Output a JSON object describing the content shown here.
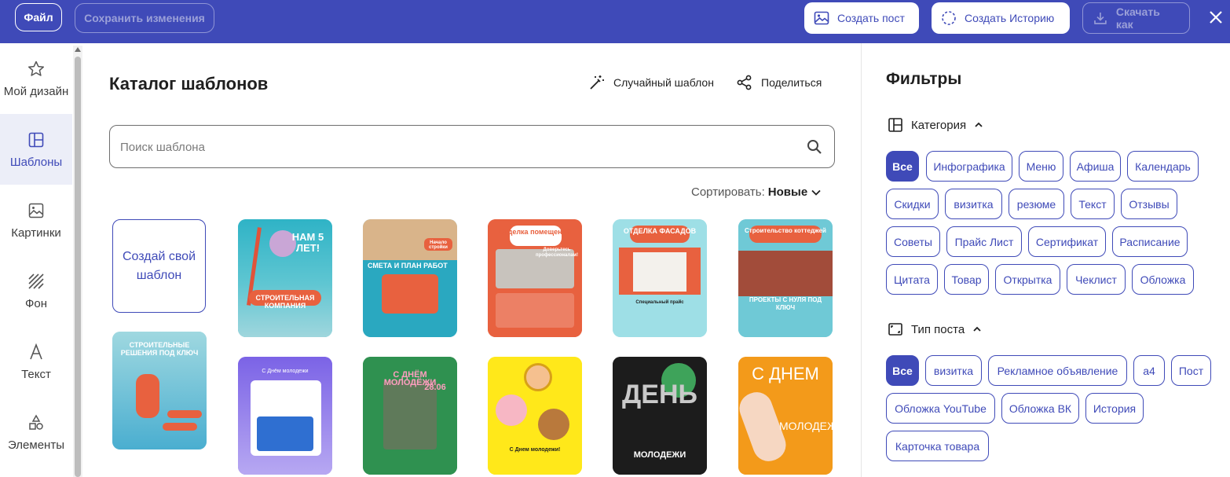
{
  "topbar": {
    "file_label": "Файл",
    "save_label": "Сохранить изменения",
    "create_post_label": "Создать пост",
    "create_story_label": "Создать Историю",
    "download_label": "Скачать как",
    "accent_color": "#3f4ab8"
  },
  "sidebar": {
    "items": [
      {
        "label": "Мой дизайн",
        "icon": "star-icon"
      },
      {
        "label": "Шаблоны",
        "icon": "template-icon"
      },
      {
        "label": "Картинки",
        "icon": "image-icon"
      },
      {
        "label": "Фон",
        "icon": "pattern-icon"
      },
      {
        "label": "Текст",
        "icon": "text-icon"
      },
      {
        "label": "Элементы",
        "icon": "shapes-icon"
      }
    ]
  },
  "catalog": {
    "title": "Каталог шаблонов",
    "random_label": "Случайный шаблон",
    "share_label": "Поделиться",
    "search_placeholder": "Поиск шаблона",
    "sort_prefix": "Сортировать:",
    "sort_value": "Новые",
    "create_own_label": "Создай свой шаблон",
    "templates": [
      {
        "title": "НАМ 5 ЛЕТ!",
        "subtitle": "СТРОИТЕЛЬНАЯ КОМПАНИЯ"
      },
      {
        "title": "СМЕТА И ПЛАН РАБОТ",
        "subtitle": "Начало стройки"
      },
      {
        "title": "Отделка помещений",
        "subtitle": "Доверьтесь профессионалам!"
      },
      {
        "title": "ОТДЕЛКА ФАСАДОВ",
        "subtitle": "Специальный прайс"
      },
      {
        "title": "Строительство коттеджей",
        "subtitle": "ПРОЕКТЫ С НУЛЯ ПОД КЛЮЧ"
      },
      {
        "title": "СТРОИТЕЛЬНЫЕ РЕШЕНИЯ ПОД КЛЮЧ",
        "subtitle": ""
      },
      {
        "title": "С Днём молодежи",
        "subtitle": ""
      },
      {
        "title": "С ДНЁМ МОЛОДЁЖИ",
        "subtitle": "28.06"
      },
      {
        "title": "С Днем молодежи!",
        "subtitle": ""
      },
      {
        "title": "ДЕНЬ",
        "subtitle": "МОЛОДЕЖИ"
      },
      {
        "title": "С ДНЕМ",
        "subtitle": "МОЛОДЕЖИ"
      }
    ]
  },
  "filters": {
    "title": "Фильтры",
    "category_label": "Категория",
    "category_chips": [
      "Все",
      "Инфографика",
      "Меню",
      "Афиша",
      "Календарь",
      "Скидки",
      "визитка",
      "резюме",
      "Текст",
      "Отзывы",
      "Советы",
      "Прайс Лист",
      "Сертификат",
      "Расписание",
      "Цитата",
      "Товар",
      "Открытка",
      "Чеклист",
      "Обложка"
    ],
    "post_type_label": "Тип поста",
    "post_type_chips": [
      "Все",
      "визитка",
      "Рекламное объявление",
      "а4",
      "Пост",
      "Обложка YouTube",
      "Обложка ВК",
      "История",
      "Карточка товара"
    ]
  }
}
